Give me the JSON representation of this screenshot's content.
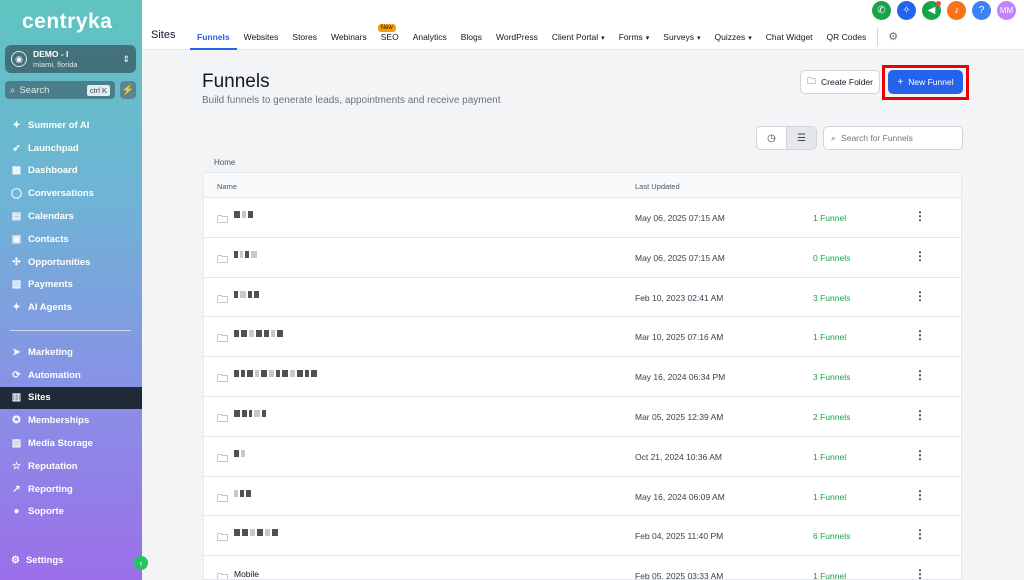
{
  "brand": {
    "logo_text": "centryka",
    "logo_dot": "."
  },
  "account": {
    "name": "DEMO - I",
    "location": "miami, florida"
  },
  "sidebar_search": {
    "placeholder": "Search",
    "shortcut": "ctrl K"
  },
  "sidebar": {
    "items": [
      {
        "label": "Summer of AI",
        "icon": "sparkle-icon",
        "glyph": "✦"
      },
      {
        "label": "Launchpad",
        "icon": "rocket-icon",
        "glyph": "➶"
      },
      {
        "label": "Dashboard",
        "icon": "dashboard-icon",
        "glyph": "▦"
      },
      {
        "label": "Conversations",
        "icon": "chat-icon",
        "glyph": "◯"
      },
      {
        "label": "Calendars",
        "icon": "calendar-icon",
        "glyph": "▤"
      },
      {
        "label": "Contacts",
        "icon": "contacts-icon",
        "glyph": "▣"
      },
      {
        "label": "Opportunities",
        "icon": "opportunities-icon",
        "glyph": "✣"
      },
      {
        "label": "Payments",
        "icon": "payments-icon",
        "glyph": "▧"
      },
      {
        "label": "AI Agents",
        "icon": "ai-agents-icon",
        "glyph": "✦"
      }
    ],
    "items2": [
      {
        "label": "Marketing",
        "icon": "marketing-icon",
        "glyph": "➤"
      },
      {
        "label": "Automation",
        "icon": "automation-icon",
        "glyph": "⟳"
      },
      {
        "label": "Sites",
        "icon": "sites-icon",
        "glyph": "▥",
        "active": true
      },
      {
        "label": "Memberships",
        "icon": "memberships-icon",
        "glyph": "✪"
      },
      {
        "label": "Media Storage",
        "icon": "media-icon",
        "glyph": "▨"
      },
      {
        "label": "Reputation",
        "icon": "star-icon",
        "glyph": "☆"
      },
      {
        "label": "Reporting",
        "icon": "reporting-icon",
        "glyph": "↗"
      },
      {
        "label": "Soporte",
        "icon": "support-icon",
        "glyph": "●"
      }
    ],
    "settings_label": "Settings"
  },
  "topbar": {
    "section_title": "Sites",
    "tabs": [
      {
        "label": "Funnels",
        "active": true
      },
      {
        "label": "Websites"
      },
      {
        "label": "Stores"
      },
      {
        "label": "Webinars"
      },
      {
        "label": "SEO",
        "badge": "New"
      },
      {
        "label": "Analytics"
      },
      {
        "label": "Blogs"
      },
      {
        "label": "WordPress"
      },
      {
        "label": "Client Portal",
        "dropdown": true
      },
      {
        "label": "Forms",
        "dropdown": true
      },
      {
        "label": "Surveys",
        "dropdown": true
      },
      {
        "label": "Quizzes",
        "dropdown": true
      },
      {
        "label": "Chat Widget"
      },
      {
        "label": "QR Codes"
      }
    ],
    "icons": [
      {
        "name": "phone-icon",
        "glyph": "✆",
        "color": "#16a34a"
      },
      {
        "name": "magic-icon",
        "glyph": "✧",
        "color": "#2563eb"
      },
      {
        "name": "megaphone-icon",
        "glyph": "◀",
        "color": "#16a34a",
        "dot": true
      },
      {
        "name": "bell-icon",
        "glyph": "♪",
        "color": "#f97316"
      },
      {
        "name": "help-icon",
        "glyph": "?",
        "color": "#3b82f6"
      },
      {
        "name": "user-avatar",
        "glyph": "MM",
        "color": "#c084fc"
      }
    ]
  },
  "main": {
    "title": "Funnels",
    "subtitle": "Build funnels to generate leads, appointments and receive payment",
    "create_folder_label": "Create Folder",
    "new_funnel_label": "New Funnel",
    "search_placeholder": "Search for Funnels",
    "breadcrumb": "Home",
    "columns": {
      "name": "Name",
      "last_updated": "Last Updated"
    }
  },
  "rows": [
    {
      "name": "",
      "updated": "May 06, 2025 07:15 AM",
      "count": "1 Funnel"
    },
    {
      "name": "",
      "updated": "May 06, 2025 07:15 AM",
      "count": "0 Funnels"
    },
    {
      "name": "",
      "updated": "Feb 10, 2023 02:41 AM",
      "count": "3 Funnels"
    },
    {
      "name": "",
      "updated": "Mar 10, 2025 07:16 AM",
      "count": "1 Funnel"
    },
    {
      "name": "",
      "updated": "May 16, 2024 06:34 PM",
      "count": "3 Funnels"
    },
    {
      "name": "",
      "updated": "Mar 05, 2025 12:39 AM",
      "count": "2 Funnels"
    },
    {
      "name": "",
      "updated": "Oct 21, 2024 10:36 AM",
      "count": "1 Funnel"
    },
    {
      "name": "",
      "updated": "May 16, 2024 06:09 AM",
      "count": "1 Funnel"
    },
    {
      "name": "",
      "updated": "Feb 04, 2025 11:40 PM",
      "count": "6 Funnels"
    },
    {
      "name": "Mobile",
      "updated": "Feb 05, 2025 03:33 AM",
      "count": "1 Funnel"
    }
  ]
}
